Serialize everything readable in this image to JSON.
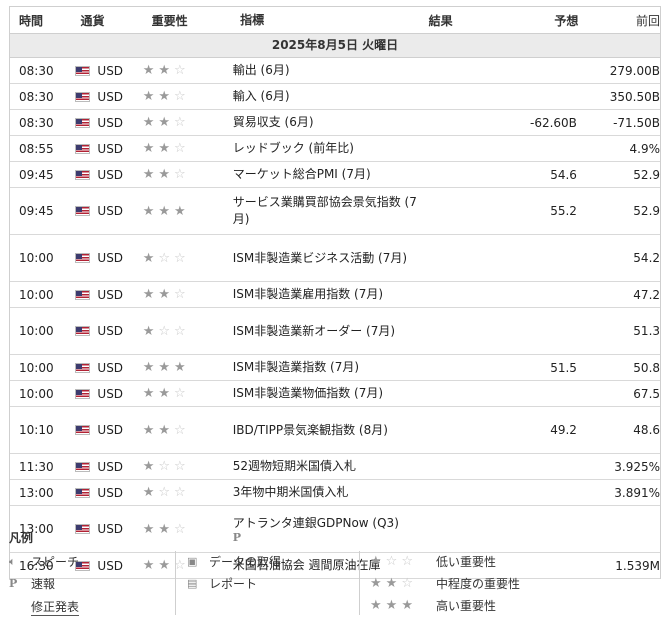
{
  "table": {
    "headers": {
      "time": "時間",
      "currency": "通貨",
      "importance": "重要性",
      "indicator": "指標",
      "actual": "結果",
      "forecast": "予想",
      "previous": "前回"
    },
    "date": "2025年8月5日 火曜日",
    "rows": [
      {
        "time": "08:30",
        "currency": "USD",
        "stars": 2,
        "indicator": "輸出 (6月)",
        "actual": "",
        "forecast": "",
        "previous": "279.00B",
        "note": ""
      },
      {
        "time": "08:30",
        "currency": "USD",
        "stars": 2,
        "indicator": "輸入 (6月)",
        "actual": "",
        "forecast": "",
        "previous": "350.50B",
        "note": ""
      },
      {
        "time": "08:30",
        "currency": "USD",
        "stars": 2,
        "indicator": "貿易収支 (6月)",
        "actual": "",
        "forecast": "-62.60B",
        "previous": "-71.50B",
        "note": ""
      },
      {
        "time": "08:55",
        "currency": "USD",
        "stars": 2,
        "indicator": "レッドブック (前年比)",
        "actual": "",
        "forecast": "",
        "previous": "4.9%",
        "note": ""
      },
      {
        "time": "09:45",
        "currency": "USD",
        "stars": 2,
        "indicator": "マーケット総合PMI (7月)",
        "actual": "",
        "forecast": "54.6",
        "previous": "52.9",
        "note": ""
      },
      {
        "time": "09:45",
        "currency": "USD",
        "stars": 3,
        "indicator": "サービス業購買部協会景気指数 (7月)",
        "actual": "",
        "forecast": "55.2",
        "previous": "52.9",
        "note": ""
      },
      {
        "time": "10:00",
        "currency": "USD",
        "stars": 1,
        "indicator": "ISM非製造業ビジネス活動 (7月)",
        "actual": "",
        "forecast": "",
        "previous": "54.2",
        "note": ""
      },
      {
        "time": "10:00",
        "currency": "USD",
        "stars": 2,
        "indicator": "ISM非製造業雇用指数 (7月)",
        "actual": "",
        "forecast": "",
        "previous": "47.2",
        "note": ""
      },
      {
        "time": "10:00",
        "currency": "USD",
        "stars": 1,
        "indicator": "ISM非製造業新オーダー (7月)",
        "actual": "",
        "forecast": "",
        "previous": "51.3",
        "note": ""
      },
      {
        "time": "10:00",
        "currency": "USD",
        "stars": 3,
        "indicator": "ISM非製造業指数 (7月)",
        "actual": "",
        "forecast": "51.5",
        "previous": "50.8",
        "note": ""
      },
      {
        "time": "10:00",
        "currency": "USD",
        "stars": 2,
        "indicator": "ISM非製造業物価指数 (7月)",
        "actual": "",
        "forecast": "",
        "previous": "67.5",
        "note": ""
      },
      {
        "time": "10:10",
        "currency": "USD",
        "stars": 2,
        "indicator": "IBD/TIPP景気楽観指数 (8月)",
        "actual": "",
        "forecast": "49.2",
        "previous": "48.6",
        "note": ""
      },
      {
        "time": "11:30",
        "currency": "USD",
        "stars": 1,
        "indicator": "52週物短期米国債入札",
        "actual": "",
        "forecast": "",
        "previous": "3.925%",
        "note": ""
      },
      {
        "time": "13:00",
        "currency": "USD",
        "stars": 1,
        "indicator": "3年物中期米国債入札",
        "actual": "",
        "forecast": "",
        "previous": "3.891%",
        "note": ""
      },
      {
        "time": "13:00",
        "currency": "USD",
        "stars": 2,
        "indicator": "アトランタ連銀GDPNow (Q3)",
        "actual": "",
        "forecast": "",
        "previous": "",
        "note": "P"
      },
      {
        "time": "16:30",
        "currency": "USD",
        "stars": 2,
        "indicator": "米国石油協会 週間原油在庫",
        "actual": "",
        "forecast": "",
        "previous": "1.539M",
        "note": ""
      }
    ]
  },
  "legend": {
    "title": "凡例",
    "speech": "スピーチ",
    "preliminary_mark": "P",
    "preliminary": "速報",
    "revised": "修正発表",
    "data_retrieval": "データの取得",
    "report": "レポート",
    "low": "低い重要性",
    "medium": "中程度の重要性",
    "high": "高い重要性"
  }
}
